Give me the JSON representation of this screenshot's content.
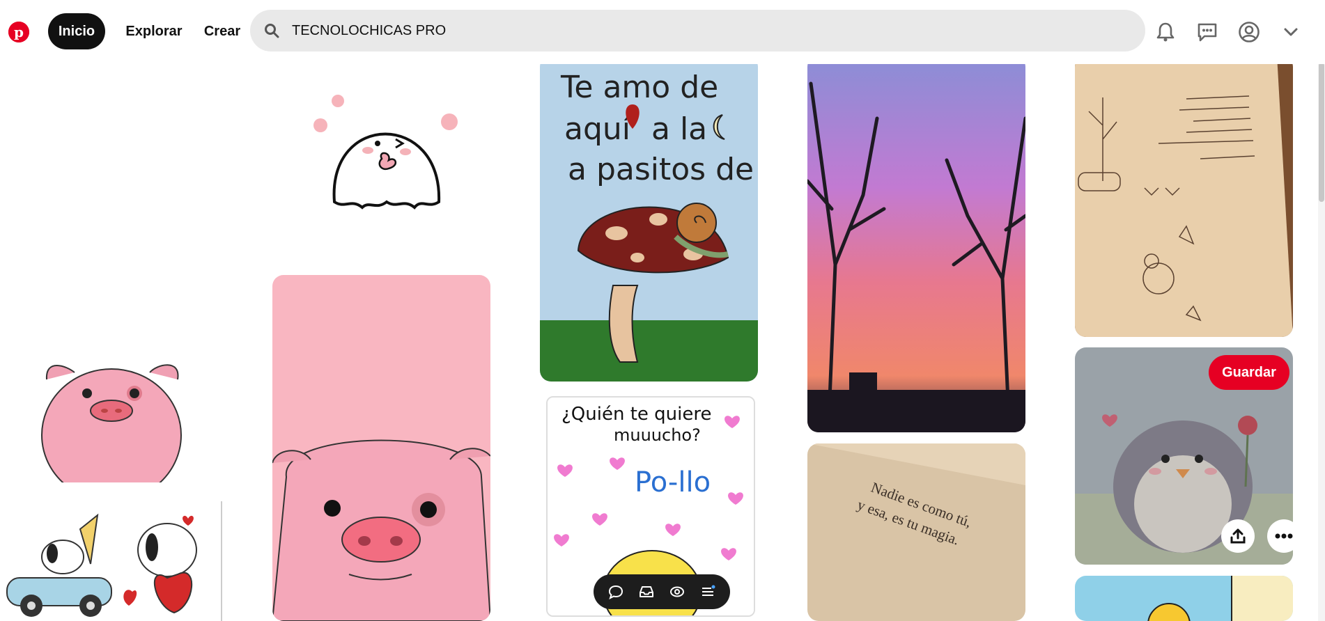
{
  "header": {
    "logo_icon": "pinterest-logo",
    "nav": [
      {
        "label": "Inicio",
        "active": true
      },
      {
        "label": "Explorar",
        "active": false
      },
      {
        "label": "Crear",
        "active": false
      }
    ],
    "search": {
      "value": "TECNOLOCHICAS PRO",
      "icon": "search-icon"
    },
    "icons": [
      "bell-icon",
      "messages-icon",
      "profile-icon",
      "chevron-down-icon"
    ]
  },
  "pins": {
    "te_amo_lines": [
      "Te amo de",
      "aquí",
      "a la",
      "a pasitos de"
    ],
    "quien_lines": [
      "¿Quién te quiere",
      "muuucho?"
    ],
    "pollo": "Po-llo",
    "nadie_lines": [
      "Nadie es como tú,",
      "y esa, es tu magia."
    ],
    "save_label": "Guardar"
  },
  "colors": {
    "brand": "#e60023",
    "search_bg": "#e9e9e9",
    "pill_active": "#111111"
  },
  "toolbar_icons": [
    "comment-icon",
    "inbox-icon",
    "eye-icon",
    "menu-icon"
  ]
}
